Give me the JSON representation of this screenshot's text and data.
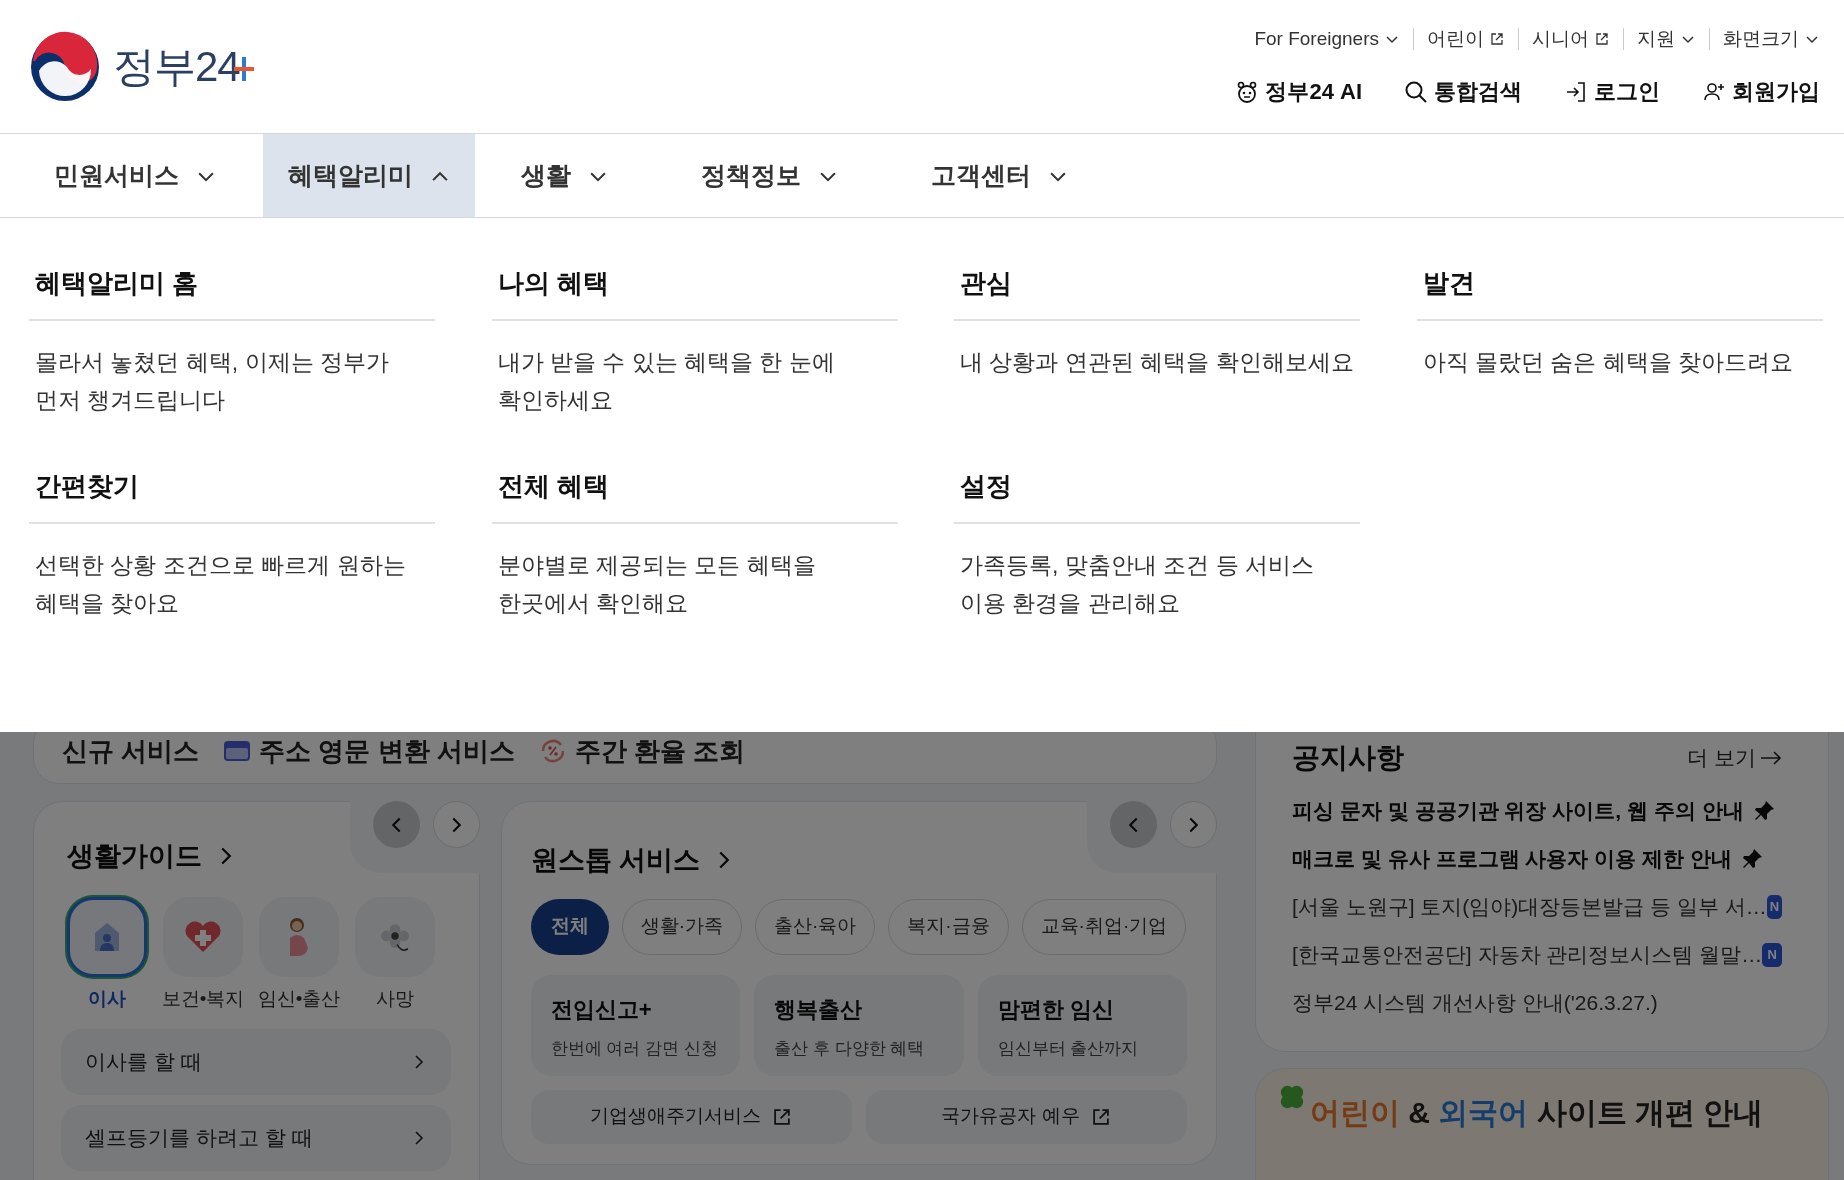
{
  "header": {
    "logo_text": "정부24",
    "utility_links": [
      {
        "label": "For Foreigners",
        "kind": "dropdown"
      },
      {
        "label": "어린이",
        "kind": "external"
      },
      {
        "label": "시니어",
        "kind": "external"
      },
      {
        "label": "지원",
        "kind": "dropdown"
      },
      {
        "label": "화면크기",
        "kind": "dropdown"
      }
    ],
    "actions": [
      {
        "label": "정부24 AI",
        "kind": "ai"
      },
      {
        "label": "통합검색",
        "kind": "search"
      },
      {
        "label": "로그인",
        "kind": "login"
      },
      {
        "label": "회원가입",
        "kind": "signup"
      }
    ]
  },
  "nav": [
    {
      "label": "민원서비스",
      "expanded": false
    },
    {
      "label": "혜택알리미",
      "expanded": true
    },
    {
      "label": "생활",
      "expanded": false
    },
    {
      "label": "정책정보",
      "expanded": false
    },
    {
      "label": "고객센터",
      "expanded": false
    }
  ],
  "mega_menu": [
    {
      "title": "혜택알리미 홈",
      "lines": [
        "몰라서 놓쳤던 혜택, 이제는 정부가",
        "먼저 챙겨드립니다"
      ]
    },
    {
      "title": "나의 혜택",
      "lines": [
        "내가 받을 수 있는 혜택을 한 눈에",
        "확인하세요"
      ]
    },
    {
      "title": "관심",
      "lines": [
        "내 상황과 연관된 혜택을 확인해보세요"
      ]
    },
    {
      "title": "발견",
      "lines": [
        "아직 몰랐던 숨은 혜택을 찾아드려요"
      ]
    },
    {
      "title": "간편찾기",
      "lines": [
        "선택한 상황 조건으로 빠르게 원하는",
        "혜택을 찾아요"
      ]
    },
    {
      "title": "전체 혜택",
      "lines": [
        "분야별로 제공되는 모든 혜택을",
        "한곳에서 확인해요"
      ]
    },
    {
      "title": "설정",
      "lines": [
        "가족등록, 맞춤안내 조건 등 서비스",
        "이용 환경을 관리해요"
      ]
    }
  ],
  "new_services": {
    "title": "신규 서비스",
    "items": [
      {
        "label": "주소 영문 변환 서비스",
        "kind": "card"
      },
      {
        "label": "주간 환율 조회",
        "kind": "exchange"
      }
    ]
  },
  "life_guide": {
    "title": "생활가이드",
    "categories": [
      {
        "label": "이사",
        "kind": "moving",
        "selected": true
      },
      {
        "label": "보건•복지",
        "kind": "health",
        "selected": false
      },
      {
        "label": "임신•출산",
        "kind": "pregnancy",
        "selected": false
      },
      {
        "label": "사망",
        "kind": "flower",
        "selected": false
      }
    ],
    "rows": [
      {
        "label": "이사를 할 때"
      },
      {
        "label": "셀프등기를 하려고 할 때"
      }
    ]
  },
  "one_stop": {
    "title": "원스톱 서비스",
    "filters": [
      {
        "label": "전체",
        "selected": true
      },
      {
        "label": "생활·가족",
        "selected": false
      },
      {
        "label": "출산·육아",
        "selected": false
      },
      {
        "label": "복지·금융",
        "selected": false
      },
      {
        "label": "교육·취업·기업",
        "selected": false
      }
    ],
    "services": [
      {
        "title": "전입신고+",
        "subtitle": "한번에 여러 감면 신청"
      },
      {
        "title": "행복출산",
        "subtitle": "출산 후 다양한 혜택"
      },
      {
        "title": "맘편한 임신",
        "subtitle": "임신부터 출산까지"
      }
    ],
    "links": [
      "기업생애주기서비스",
      "국가유공자 예우"
    ]
  },
  "notices": {
    "title": "공지사항",
    "more": "더 보기",
    "items": [
      {
        "text": "피싱 문자 및 공공기관 위장 사이트, 웹 주의 안내",
        "pinned": true
      },
      {
        "text": "매크로 및 유사 프로그램 사용자 이용 제한 안내",
        "pinned": true
      },
      {
        "text": "[서울 노원구] 토지(임야)대장등본발급 등 일부 서…",
        "pinned": false,
        "badge": "N"
      },
      {
        "text": "[한국교통안전공단] 자동차 관리정보시스템 월말…",
        "pinned": false,
        "badge": "N"
      },
      {
        "text": "정부24 시스템 개선사항 안내('26.3.27.)",
        "pinned": false
      }
    ]
  },
  "banner": {
    "segments": [
      {
        "text": "어린이",
        "kind": "warm"
      },
      {
        "text": "&",
        "kind": "plain"
      },
      {
        "text": "외국어",
        "kind": "cool"
      },
      {
        "text": "사이트 개편 안내",
        "kind": "plain"
      }
    ]
  }
}
